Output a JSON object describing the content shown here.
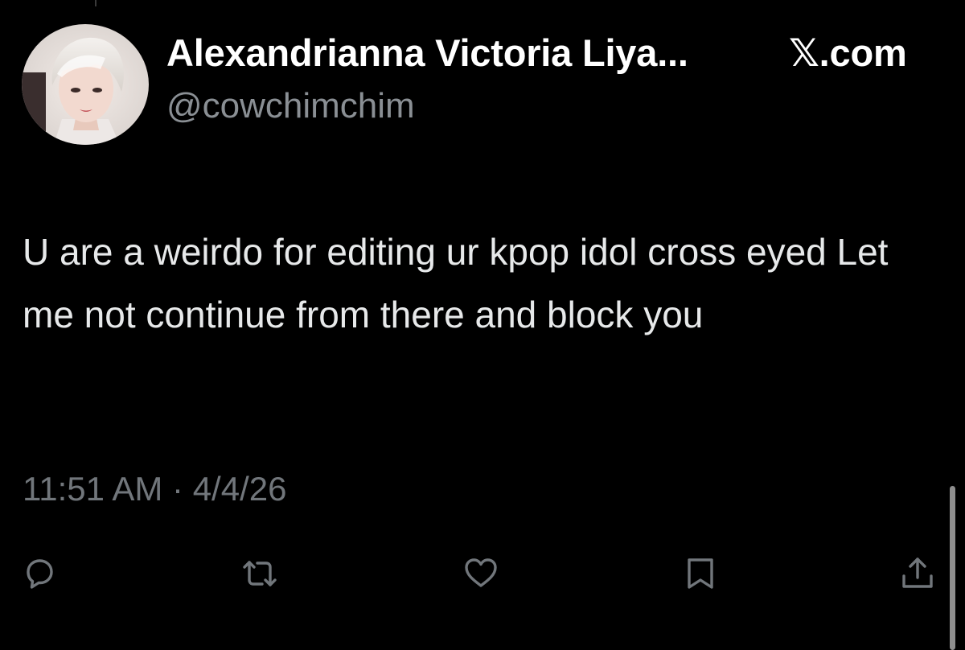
{
  "tweet": {
    "author": {
      "display_name": "Alexandrianna Victoria Liya...",
      "handle": "@cowchimchim",
      "avatar_icon": "profile-photo"
    },
    "source_label": "𝕏.com",
    "text": "U are a weirdo for editing ur kpop idol cross eyed Let me not continue from there and block you",
    "time": "11:51 AM",
    "separator": "·",
    "date": "4/4/26"
  },
  "actions": [
    {
      "name": "reply",
      "icon": "speech-bubble-icon"
    },
    {
      "name": "repost",
      "icon": "repost-arrows-icon"
    },
    {
      "name": "like",
      "icon": "heart-icon"
    },
    {
      "name": "bookmark",
      "icon": "bookmark-icon"
    },
    {
      "name": "share",
      "icon": "share-upload-icon"
    }
  ],
  "colors": {
    "background": "#000000",
    "primary_text": "#e7e9ea",
    "secondary_text": "#71767b",
    "icon": "#71767b"
  }
}
